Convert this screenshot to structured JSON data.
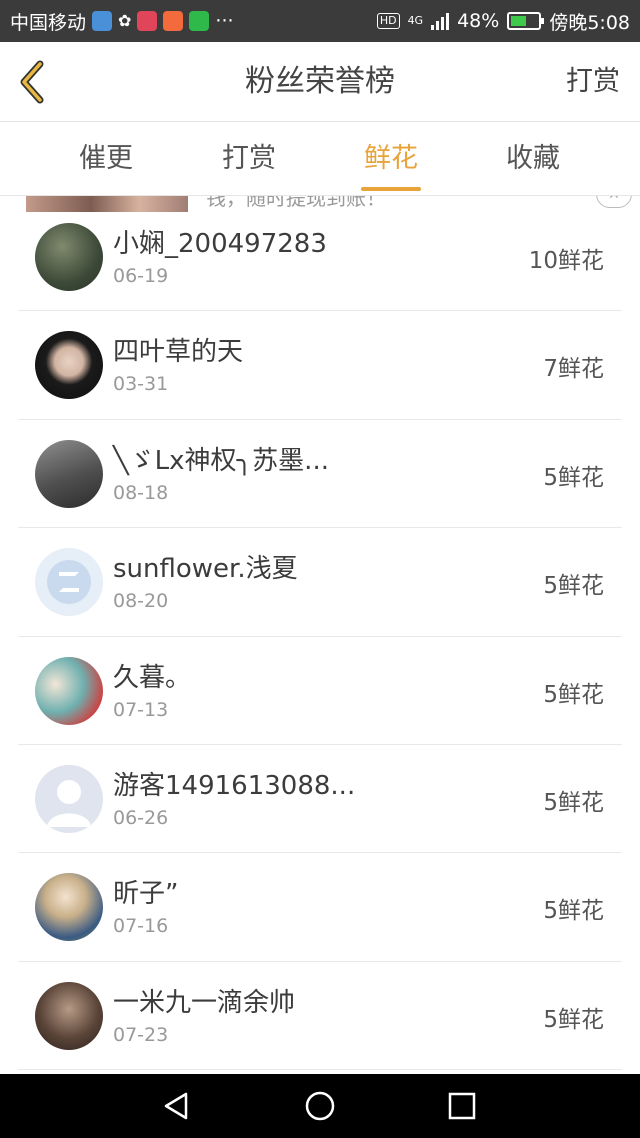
{
  "status_bar": {
    "carrier": "中国移动",
    "hd": "HD",
    "network": "4G",
    "battery_percent": "48%",
    "time": "傍晚5:08",
    "battery_level": 0.48,
    "accent_green": "#3fc94a"
  },
  "header": {
    "title": "粉丝荣誉榜",
    "action": "打赏",
    "back_icon": "chevron-left-icon"
  },
  "tabs": [
    {
      "label": "催更",
      "active": false
    },
    {
      "label": "打赏",
      "active": false
    },
    {
      "label": "鲜花",
      "active": true
    },
    {
      "label": "收藏",
      "active": false
    }
  ],
  "accent_color": "#e8a33a",
  "banner": {
    "text": "钱，随时提现到账！"
  },
  "fans": [
    {
      "name": "小娴_200497283",
      "date": "06-19",
      "amount": "10鲜花"
    },
    {
      "name": "四叶草的天",
      "date": "03-31",
      "amount": "7鲜花"
    },
    {
      "name": "╲ゞLx神权╮苏墨...",
      "date": "08-18",
      "amount": "5鲜花"
    },
    {
      "name": "sunflower.浅夏",
      "date": "08-20",
      "amount": "5鲜花"
    },
    {
      "name": "久暮。",
      "date": "07-13",
      "amount": "5鲜花"
    },
    {
      "name": "游客1491613088...",
      "date": "06-26",
      "amount": "5鲜花"
    },
    {
      "name": "昕子”",
      "date": "07-16",
      "amount": "5鲜花"
    },
    {
      "name": "一米九一滴余帅",
      "date": "07-23",
      "amount": "5鲜花"
    }
  ],
  "nav": {
    "back": "back-triangle-icon",
    "home": "home-circle-icon",
    "recents": "recents-square-icon"
  }
}
